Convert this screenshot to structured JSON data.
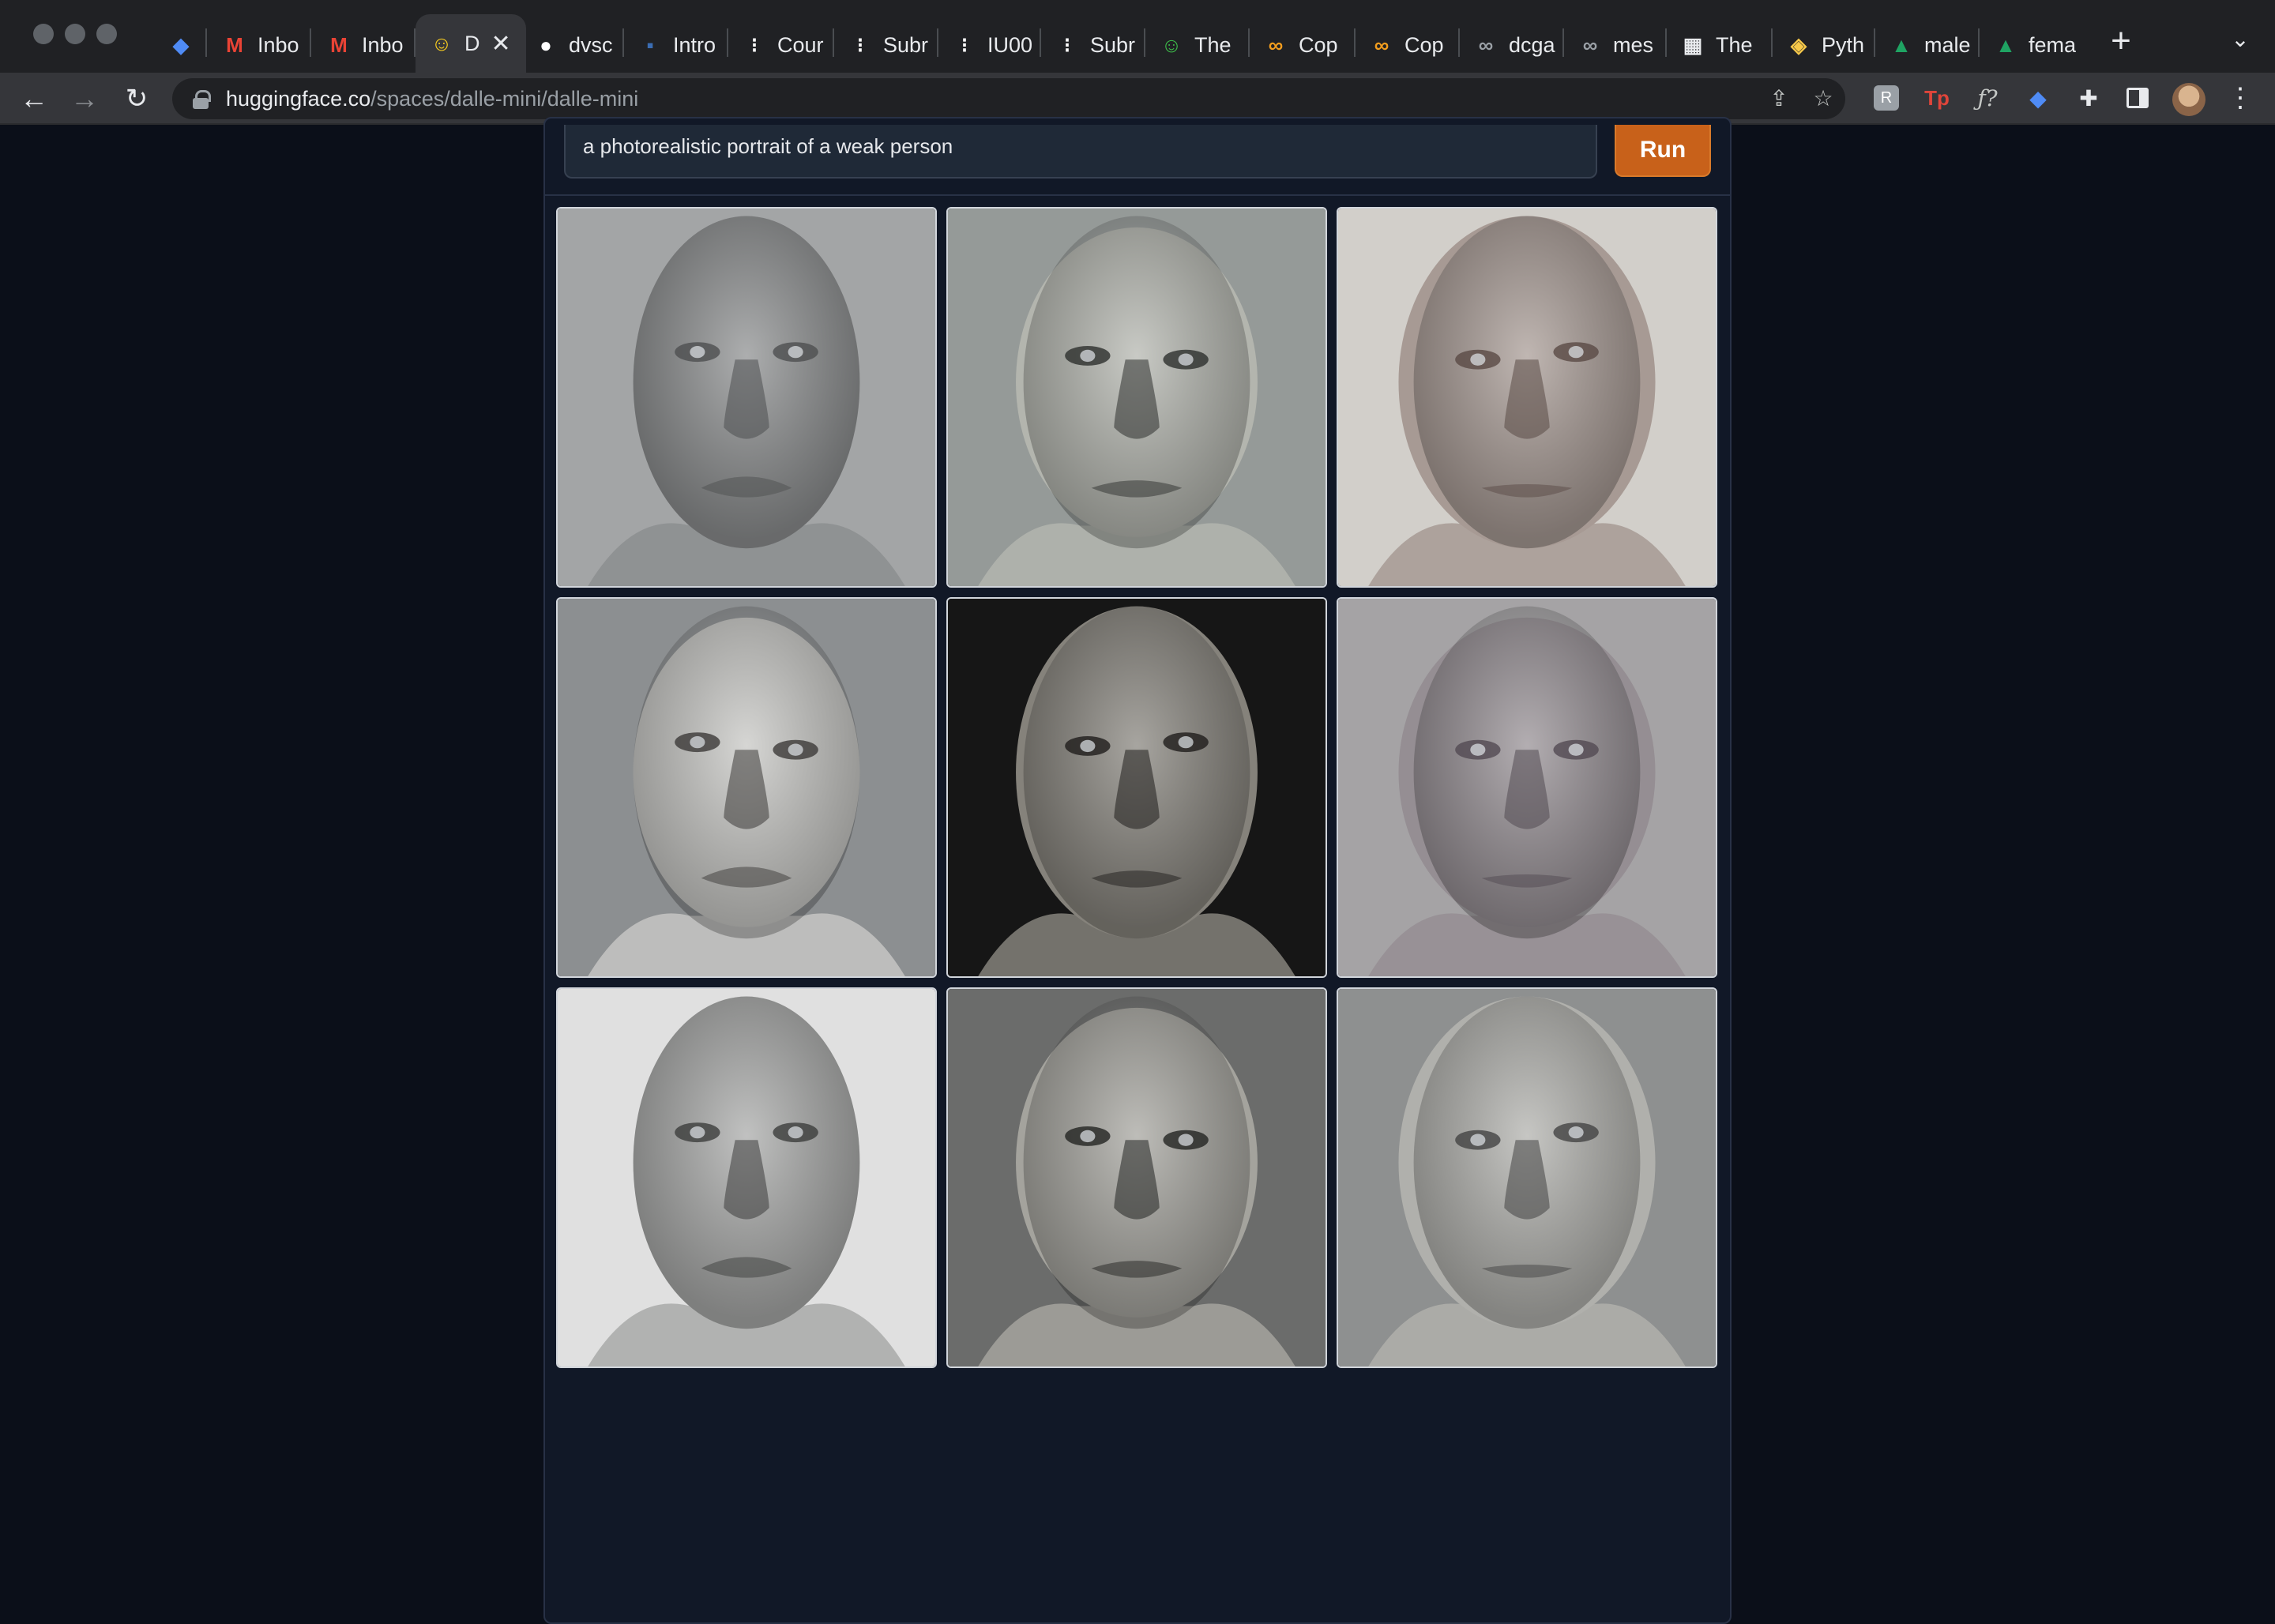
{
  "browser": {
    "tabs": [
      {
        "label": "",
        "icon": "gem-icon",
        "color": "#4f8bf5"
      },
      {
        "label": "Inbo",
        "icon": "gmail-icon",
        "color": "#ea4335"
      },
      {
        "label": "Inbo",
        "icon": "gmail-icon",
        "color": "#ea4335"
      },
      {
        "label": "D",
        "icon": "hugging-face-icon",
        "color": "#ffd21e",
        "active": true
      },
      {
        "label": "dvsc",
        "icon": "github-icon",
        "color": "#ffffff"
      },
      {
        "label": "Intro",
        "icon": "tds-icon",
        "color": "#3b6db3"
      },
      {
        "label": "Cour",
        "icon": "notion-icon",
        "color": "#ffffff"
      },
      {
        "label": "Subr",
        "icon": "notion-icon",
        "color": "#ffffff"
      },
      {
        "label": "IU00",
        "icon": "notion-icon",
        "color": "#ffffff"
      },
      {
        "label": "Subr",
        "icon": "notion-icon",
        "color": "#ffffff"
      },
      {
        "label": "The",
        "icon": "smiley-icon",
        "color": "#3dbd4a"
      },
      {
        "label": "Cop",
        "icon": "infinity-icon",
        "color": "#f29d1e"
      },
      {
        "label": "Cop",
        "icon": "infinity-icon",
        "color": "#f29d1e"
      },
      {
        "label": "dcga",
        "icon": "infinity-icon",
        "color": "#9aa0a6"
      },
      {
        "label": "mes",
        "icon": "infinity-icon",
        "color": "#9aa0a6"
      },
      {
        "label": "The",
        "icon": "qr-icon",
        "color": "#e8eaed"
      },
      {
        "label": "Pyth",
        "icon": "python-icon",
        "color": "#f7c94a"
      },
      {
        "label": "male",
        "icon": "drive-icon",
        "color": "#1fa463"
      },
      {
        "label": "fema",
        "icon": "drive-icon",
        "color": "#1fa463"
      }
    ],
    "url_host": "huggingface.co",
    "url_path": "/spaces/dalle-mini/dalle-mini"
  },
  "app": {
    "prompt_text": "a photorealistic portrait of a weak person",
    "run_label": "Run",
    "images": [
      {
        "name": "generated-face-1",
        "bg": "#a3a5a6",
        "skin": "#8c8e8f",
        "dark": "#4d4f50"
      },
      {
        "name": "generated-face-2",
        "bg": "#959a98",
        "skin": "#b3b5ae",
        "dark": "#2d2f2d"
      },
      {
        "name": "generated-face-3",
        "bg": "#d2cfca",
        "skin": "#a79a94",
        "dark": "#5a4a45"
      },
      {
        "name": "generated-face-4",
        "bg": "#8c8f91",
        "skin": "#c6c6c3",
        "dark": "#3c3a38"
      },
      {
        "name": "generated-face-5",
        "bg": "#161616",
        "skin": "#85827b",
        "dark": "#1f1d1b"
      },
      {
        "name": "generated-face-6",
        "bg": "#a5a3a5",
        "skin": "#958e93",
        "dark": "#524a52"
      },
      {
        "name": "generated-face-7",
        "bg": "#e0e0e0",
        "skin": "#a8a9a8",
        "dark": "#3c3d3c"
      },
      {
        "name": "generated-face-8",
        "bg": "#6b6c6b",
        "skin": "#a4a39d",
        "dark": "#232422"
      },
      {
        "name": "generated-face-9",
        "bg": "#8e9090",
        "skin": "#b0b0ac",
        "dark": "#434443"
      }
    ]
  }
}
